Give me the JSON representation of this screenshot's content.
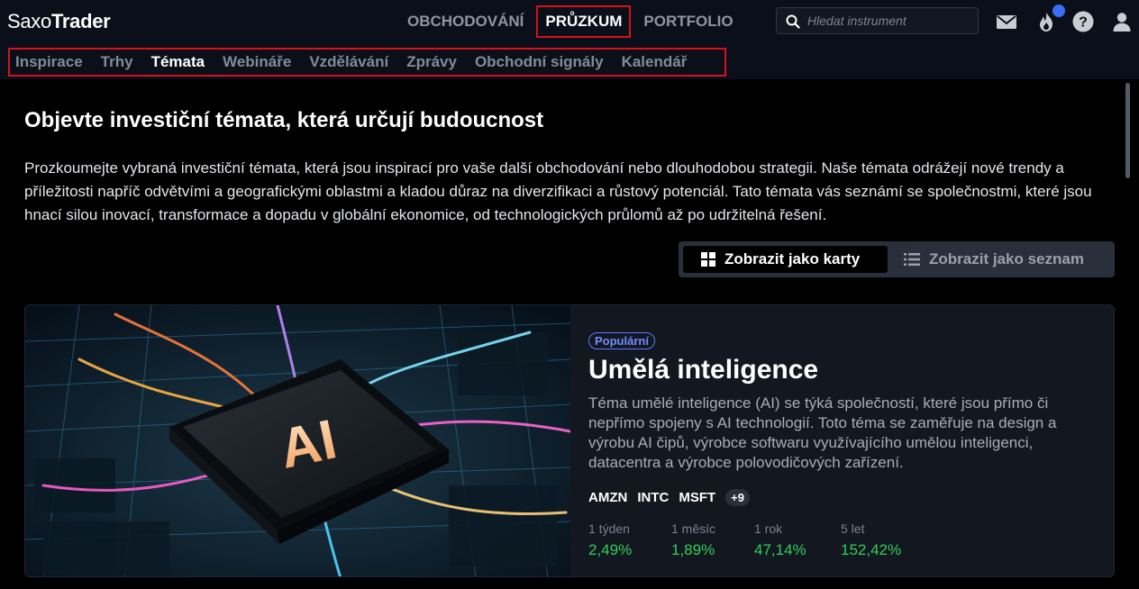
{
  "app": {
    "logo_light": "Saxo",
    "logo_bold": "Trader"
  },
  "main_nav": [
    {
      "label": "OBCHODOVÁNÍ"
    },
    {
      "label": "PRŮZKUM"
    },
    {
      "label": "PORTFOLIO"
    }
  ],
  "search": {
    "placeholder": "Hledat instrument"
  },
  "top_icons": [
    "mail-icon",
    "flame-icon",
    "help-icon",
    "user-icon"
  ],
  "sub_nav": [
    {
      "label": "Inspirace"
    },
    {
      "label": "Trhy"
    },
    {
      "label": "Témata"
    },
    {
      "label": "Webináře"
    },
    {
      "label": "Vzdělávání"
    },
    {
      "label": "Zprávy"
    },
    {
      "label": "Obchodní signály"
    },
    {
      "label": "Kalendář"
    }
  ],
  "page": {
    "title": "Objevte investiční témata, která určují budoucnost",
    "intro": "Prozkoumejte vybraná investiční témata, která jsou inspirací pro vaše další obchodování nebo dlouhodobou strategii. Naše témata odrážejí nové trendy a příležitosti napříč odvětvími a geografickými oblastmi a kladou důraz na diverzifikaci a růstový potenciál. Tato témata vás seznámí se společnostmi, které jsou hnací silou inovací, transformace a dopadu v globální ekonomice, od technologických průlomů až po udržitelná řešení."
  },
  "view_toggle": {
    "cards_label": "Zobrazit jako karty",
    "list_label": "Zobrazit jako seznam"
  },
  "theme_card": {
    "image_text": "AI",
    "badge": "Populární",
    "title": "Umělá inteligence",
    "description": "Téma umělé inteligence (AI) se týká společností, které jsou přímo či nepřímo spojeny s AI technologií. Toto téma se zaměřuje na design a výrobu AI čipů, výrobce softwaru využívajícího umělou inteligenci, datacentra a výrobce polovodičových zařízení.",
    "tickers": [
      "AMZN",
      "INTC",
      "MSFT"
    ],
    "more": "+9",
    "performance": [
      {
        "label": "1 týden",
        "value": "2,49%"
      },
      {
        "label": "1 měsíc",
        "value": "1,89%"
      },
      {
        "label": "1 rok",
        "value": "47,14%"
      },
      {
        "label": "5 let",
        "value": "152,42%"
      }
    ]
  },
  "colors": {
    "accent_red": "#d6121b",
    "positive": "#2fcf5a",
    "badge_blue": "#5b7cff",
    "notification": "#3b6ef5"
  }
}
